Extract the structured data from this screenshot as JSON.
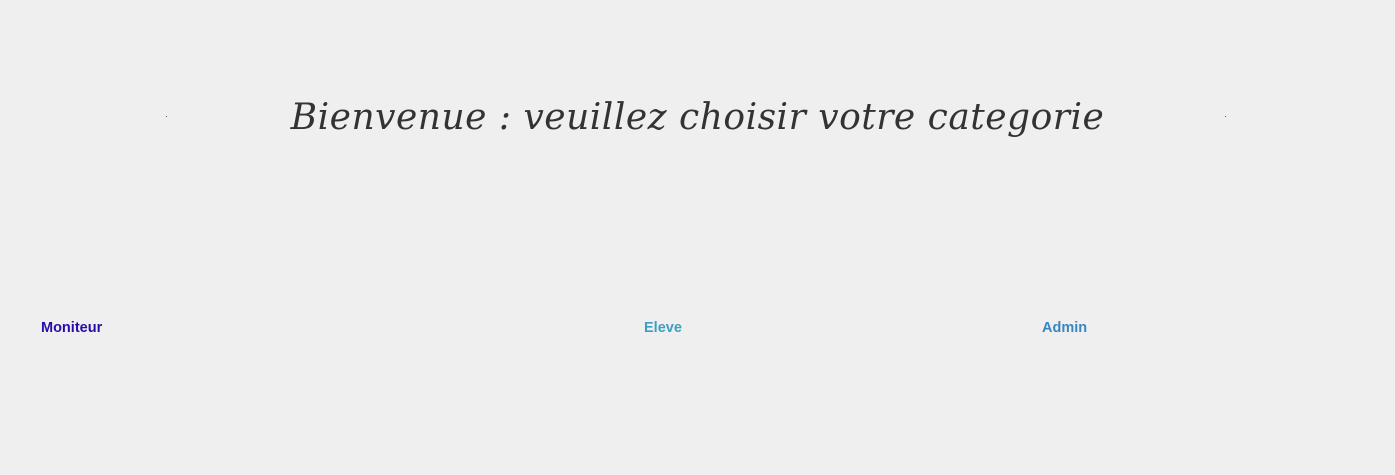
{
  "header": {
    "title": "Bienvenue : veuillez choisir votre categorie"
  },
  "categories": [
    {
      "label": "Moniteur",
      "color": "#2a0aa8"
    },
    {
      "label": "Eleve",
      "color": "#3f9fc0"
    },
    {
      "label": "Admin",
      "color": "#3a86c0"
    }
  ],
  "colors": {
    "background": "#efefef",
    "title": "#333333"
  }
}
